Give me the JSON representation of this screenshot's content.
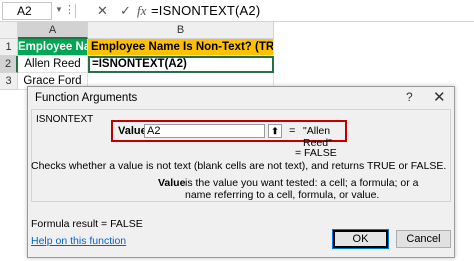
{
  "formula_bar": {
    "name_box": "A2",
    "cancel_icon": "✕",
    "enter_icon": "✓",
    "fx_icon": "fx",
    "formula": "=ISNONTEXT(A2)"
  },
  "columns": [
    "A",
    "B"
  ],
  "rows": [
    "1",
    "2",
    "3"
  ],
  "cells": {
    "a1": "Employee Name",
    "b1": "Employee Name Is Non-Text? (TRUE/FALSE)",
    "a2": "Allen Reed",
    "b2": "=ISNONTEXT(A2)",
    "a3": "Grace Ford"
  },
  "dialog": {
    "title": "Function Arguments",
    "help_icon": "?",
    "close_icon": "✕",
    "function_name": "ISNONTEXT",
    "value_label": "Value",
    "value_input": "A2",
    "collapse_icon": "⬆",
    "equals": "=",
    "arg_result": "\"Allen Reed\"",
    "result_line": "=  FALSE",
    "description": "Checks whether a value is not text (blank cells are not text), and returns TRUE or FALSE.",
    "arg_name": "Value",
    "arg_description": "is the value you want tested: a cell; a formula; or a name referring to a cell, formula, or value.",
    "formula_result": "Formula result =   FALSE",
    "help_link": "Help on this function",
    "ok_label": "OK",
    "cancel_label": "Cancel"
  },
  "colors": {
    "header_green": "#00a651",
    "header_amber": "#ffc000",
    "highlight_red": "#c00000"
  }
}
